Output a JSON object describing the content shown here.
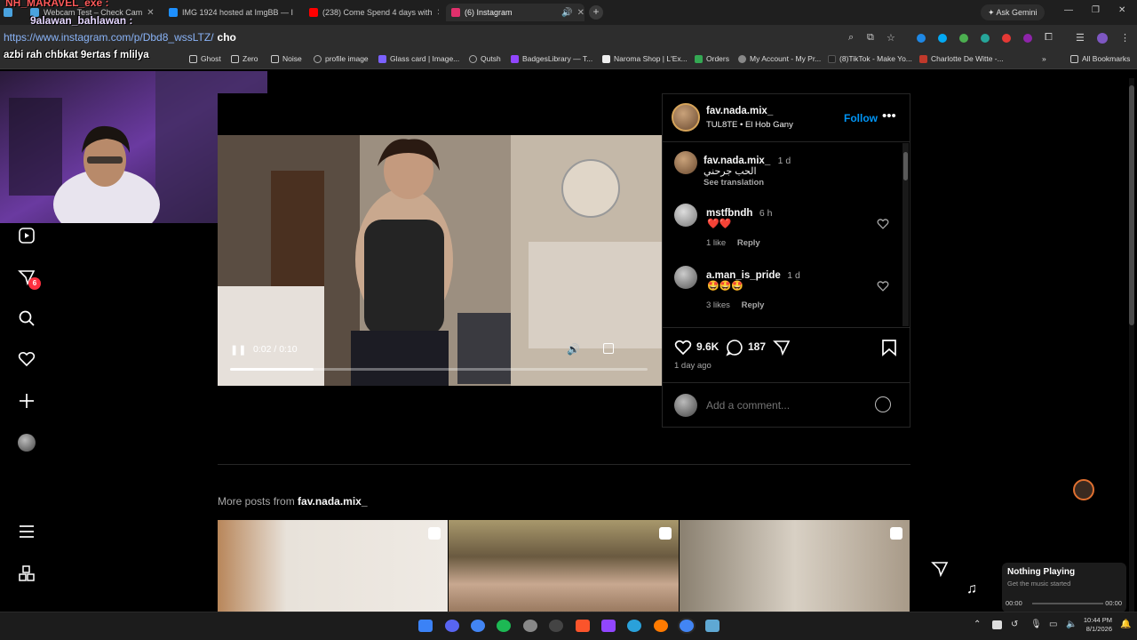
{
  "browser": {
    "tabs": [
      {
        "title": "Webcam Test – Check Cam",
        "color": "#4aa3df"
      },
      {
        "title": "IMG 1924 hosted at ImgBB — I",
        "color": "#1e90ff"
      },
      {
        "title": "(238) Come Spend 4 days with",
        "color": "#ff0000"
      },
      {
        "title": "(6) Instagram",
        "color": "#e1306c"
      }
    ],
    "ask_gemini": "Ask Gemini",
    "url": "https://www.instagram.com/p/Dbd8_wssLTZ/",
    "url_suffix": "cho",
    "bookmarks": [
      {
        "label": "Ghost",
        "color": "#888"
      },
      {
        "label": "Zero",
        "color": "#888"
      },
      {
        "label": "Noise",
        "color": "#888"
      },
      {
        "label": "profile image",
        "color": "#aaa"
      },
      {
        "label": "Glass card | Image...",
        "color": "#7b61ff"
      },
      {
        "label": "Qutsh",
        "color": "#aaa"
      },
      {
        "label": "BadgesLibrary — T...",
        "color": "#9146ff"
      },
      {
        "label": "Naroma Shop | L'Ex...",
        "color": "#222"
      },
      {
        "label": "Orders",
        "color": "#34a853"
      },
      {
        "label": "My Account - My Pr...",
        "color": "#444"
      },
      {
        "label": "(8)TikTok - Make Yo...",
        "color": "#111"
      },
      {
        "label": "Charlotte De Witte -...",
        "color": "#c0392b"
      }
    ],
    "all_bookmarks": "All Bookmarks"
  },
  "overlay": {
    "top_name": "NH_MARAVEL_exe :",
    "chat_name": "9alawan_bahlawan :",
    "chat_line": "azbi rah chbkat 9ertas f mlilya"
  },
  "sidebar": {
    "notification_badge": "6"
  },
  "post": {
    "author": "fav.nada.mix_",
    "audio": "TUL8TE • El Hob Gany",
    "follow": "Follow",
    "caption_user": "fav.nada.mix_",
    "caption_time": "1 d",
    "caption_text": "الحب جرحني",
    "see_translation": "See translation",
    "comments": [
      {
        "user": "mstfbndh",
        "time": "6 h",
        "text": "❤️❤️",
        "likes": "1 like",
        "reply": "Reply"
      },
      {
        "user": "a.man_is_pride",
        "time": "1 d",
        "text": "🤩🤩🤩",
        "likes": "3 likes",
        "reply": "Reply"
      }
    ],
    "like_count": "9.6K",
    "comment_count": "187",
    "posted": "1 day ago",
    "add_comment_placeholder": "Add a comment...",
    "video_time": "0:02 / 0:10",
    "video_progress": 0.2
  },
  "more_posts": {
    "prefix": "More posts from",
    "user": "fav.nada.mix_"
  },
  "media_widget": {
    "title": "Nothing Playing",
    "subtitle": "Get the music started",
    "time_start": "00:00",
    "time_end": "00:00"
  },
  "taskbar": {
    "time": "10:44 PM",
    "date": "8/1/2026"
  }
}
